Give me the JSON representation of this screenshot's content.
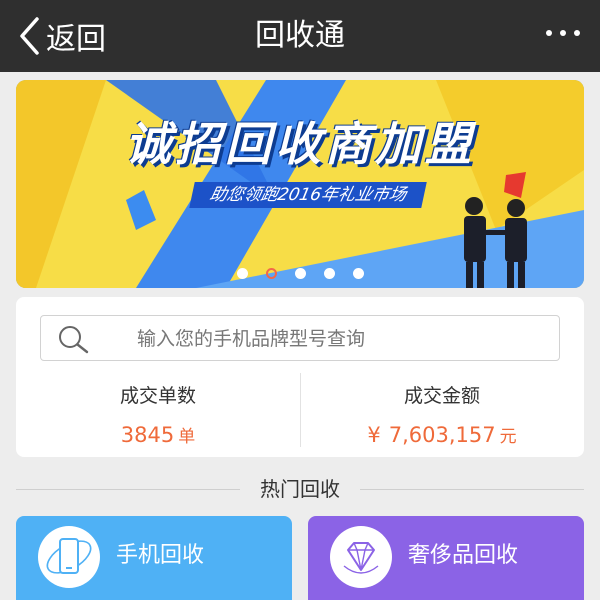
{
  "navbar": {
    "back_label": "返回",
    "title": "回收通"
  },
  "banner": {
    "headline": "诚招回收商加盟",
    "subtitle": "助您领跑2016年礼业市场",
    "slides": 5,
    "active_slide": 2
  },
  "search": {
    "placeholder": "输入您的手机品牌型号查询"
  },
  "stats": {
    "deals": {
      "label": "成交单数",
      "value": "3845",
      "unit": "单"
    },
    "amount": {
      "label": "成交金额",
      "currency": "¥",
      "value": "7,603,157",
      "unit": "元"
    }
  },
  "section": {
    "title": "热门回收"
  },
  "categories": [
    {
      "label": "手机回收",
      "icon": "phone-icon",
      "color": "#4fb1f5"
    },
    {
      "label": "奢侈品回收",
      "icon": "diamond-icon",
      "color": "#8b63e6"
    }
  ],
  "colors": {
    "accent": "#ef6a3a",
    "navbar": "#2f2f2f"
  }
}
